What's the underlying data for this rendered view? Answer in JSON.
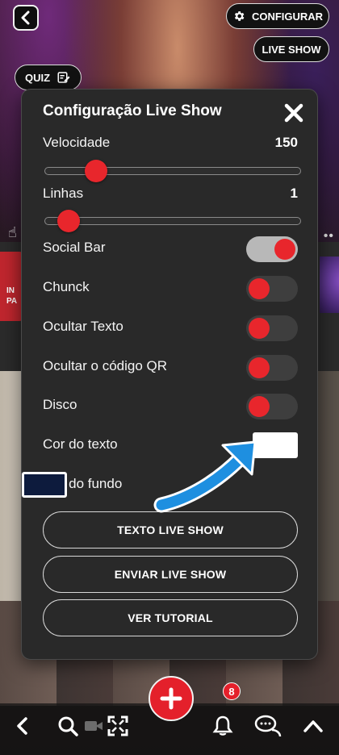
{
  "top": {
    "configurar_label": "CONFIGURAR",
    "live_show_label": "LIVE SHOW",
    "quiz_label": "QUIZ"
  },
  "modal": {
    "title": "Configuração Live Show",
    "velocidade": {
      "label": "Velocidade",
      "value": "150",
      "fraction": 0.17
    },
    "linhas": {
      "label": "Linhas",
      "value": "1",
      "fraction": 0.05
    },
    "toggles": [
      {
        "label": "Social Bar",
        "on": true
      },
      {
        "label": "Chunck",
        "on": false
      },
      {
        "label": "Ocultar Texto",
        "on": false
      },
      {
        "label": "Ocultar o código QR",
        "on": false
      },
      {
        "label": "Disco",
        "on": false
      }
    ],
    "cor_texto": {
      "label": "Cor do texto",
      "color": "#ffffff"
    },
    "cor_fundo": {
      "label": "Cor do fundo",
      "color": "#0d1b3d"
    },
    "buttons": {
      "texto": "TEXTO LIVE SHOW",
      "enviar": "ENVIAR LIVE SHOW",
      "tutorial": "VER TUTORIAL"
    }
  },
  "background": {
    "tile_text": "IN PA"
  },
  "bottom_bar": {
    "notification_count": "8"
  },
  "colors": {
    "accent_red": "#e8262c",
    "annotation_arrow": "#1e8fe0"
  }
}
